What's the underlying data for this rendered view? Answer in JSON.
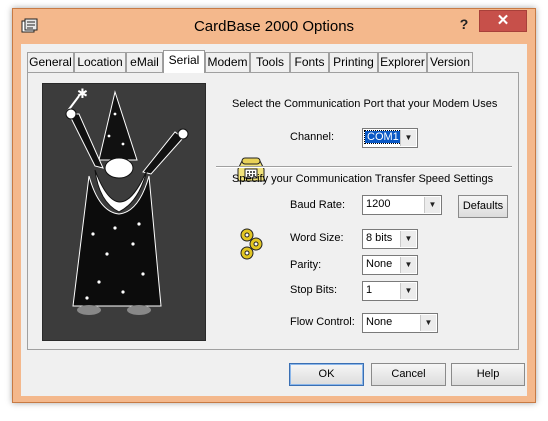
{
  "window": {
    "title": "CardBase 2000 Options",
    "help_symbol": "?",
    "close_symbol": "✕"
  },
  "tabs": [
    {
      "label": "General"
    },
    {
      "label": "Location"
    },
    {
      "label": "eMail"
    },
    {
      "label": "Serial"
    },
    {
      "label": "Modem"
    },
    {
      "label": "Tools"
    },
    {
      "label": "Fonts"
    },
    {
      "label": "Printing"
    },
    {
      "label": "Explorer"
    },
    {
      "label": "Version"
    }
  ],
  "active_tab": "Serial",
  "serial": {
    "port_heading": "Select the Communication Port that your Modem Uses",
    "channel_label": "Channel:",
    "channel_value": "COM1",
    "speed_heading": "Specify your Communication Transfer Speed Settings",
    "baud_label": "Baud Rate:",
    "baud_value": "1200",
    "defaults_label": "Defaults",
    "word_size_label": "Word Size:",
    "word_size_value": "8 bits",
    "parity_label": "Parity:",
    "parity_value": "None",
    "stop_bits_label": "Stop Bits:",
    "stop_bits_value": "1",
    "flow_control_label": "Flow Control:",
    "flow_control_value": "None"
  },
  "buttons": {
    "ok": "OK",
    "cancel": "Cancel",
    "help": "Help"
  },
  "icons": {
    "app": "card-app-icon",
    "phone": "telephone-icon",
    "gears": "gears-icon",
    "dropdown": "chevron-down-icon"
  },
  "colors": {
    "title_bar": "#f4b88c",
    "close": "#c7504a",
    "selection": "#0a58c4",
    "picture_bg": "#3c3c3c"
  }
}
